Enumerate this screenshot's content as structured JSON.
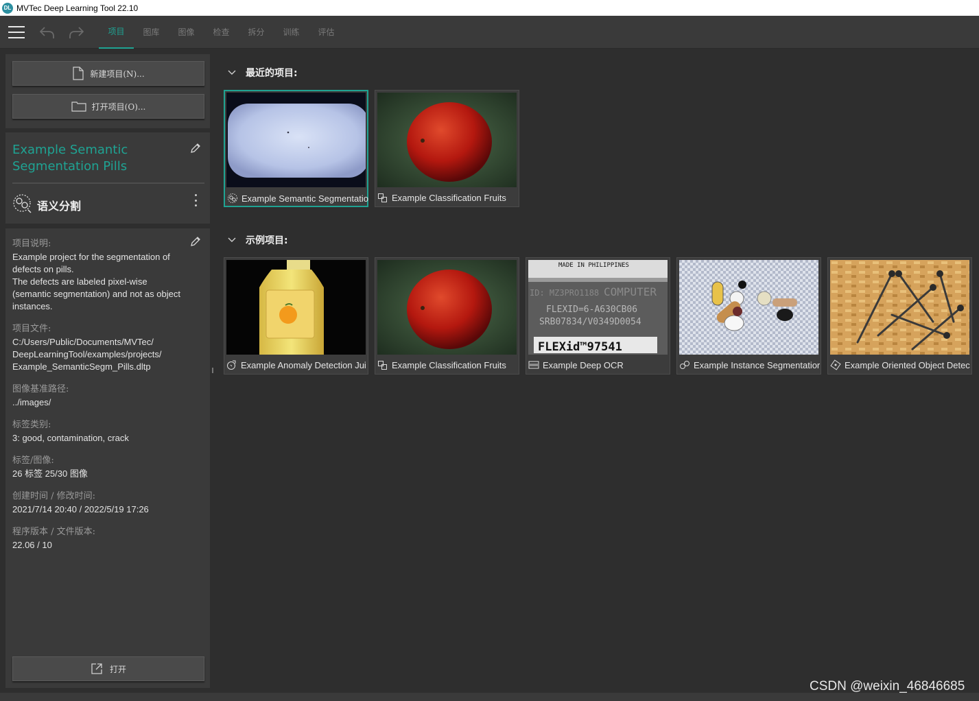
{
  "window": {
    "title": "MVTec Deep Learning Tool 22.10",
    "logo_text": "DL"
  },
  "toolbar": {
    "tabs": [
      {
        "label": "项目",
        "active": true
      },
      {
        "label": "图库"
      },
      {
        "label": "图像"
      },
      {
        "label": "检查"
      },
      {
        "label": "拆分"
      },
      {
        "label": "训练"
      },
      {
        "label": "评估"
      }
    ],
    "icons": [
      "menu-icon",
      "undo-icon",
      "redo-icon"
    ],
    "accent": "#1fa393"
  },
  "left": {
    "new_project_label": "新建项目(N)...",
    "open_project_label": "打开项目(O)...",
    "project_title": "Example Semantic Segmentation Pills",
    "project_type": "语义分割",
    "info": [
      {
        "label": "项目说明:",
        "value": "Example project for the segmentation of defects on pills.\nThe defects are labeled pixel-wise (semantic segmentation) and not as object instances."
      },
      {
        "label": "项目文件:",
        "value": "C:/Users/Public/Documents/MVTec/\nDeepLearningTool/examples/projects/\nExample_SemanticSegm_Pills.dltp"
      },
      {
        "label": "图像基准路径:",
        "value": "../images/"
      },
      {
        "label": "标签类别:",
        "value": "3: good, contamination, crack"
      },
      {
        "label": "标签/图像:",
        "value": "26 标签 25/30 图像"
      },
      {
        "label": "创建时间 / 修改时间:",
        "value": "2021/7/14 20:40 / 2022/5/19 17:26"
      },
      {
        "label": "程序版本 / 文件版本:",
        "value": "22.06 / 10"
      }
    ],
    "open_label": "打开"
  },
  "recent": {
    "heading": "最近的项目:",
    "items": [
      {
        "label": "Example Semantic Segmentatio",
        "icon": "segmentation-icon",
        "selected": true
      },
      {
        "label": "Example Classification Fruits",
        "icon": "classification-icon"
      }
    ]
  },
  "examples": {
    "heading": "示例项目:",
    "items": [
      {
        "label": "Example Anomaly Detection Jui",
        "icon": "anomaly-icon"
      },
      {
        "label": "Example Classification Fruits",
        "icon": "classification-icon"
      },
      {
        "label": "Example Deep OCR",
        "icon": "ocr-icon",
        "thumb_text": [
          "MADE IN PHILIPPINES",
          "ID: MZ3PRO1188",
          "COMPUTER",
          "FLEXID=6-A630CB06",
          "SRB07834/V0349D0054",
          "FLEXid™97541"
        ]
      },
      {
        "label": "Example Instance Segmentatior",
        "icon": "instance-icon"
      },
      {
        "label": "Example Oriented Object Detec",
        "icon": "oriented-detection-icon"
      }
    ]
  },
  "watermark": "CSDN @weixin_46846685"
}
